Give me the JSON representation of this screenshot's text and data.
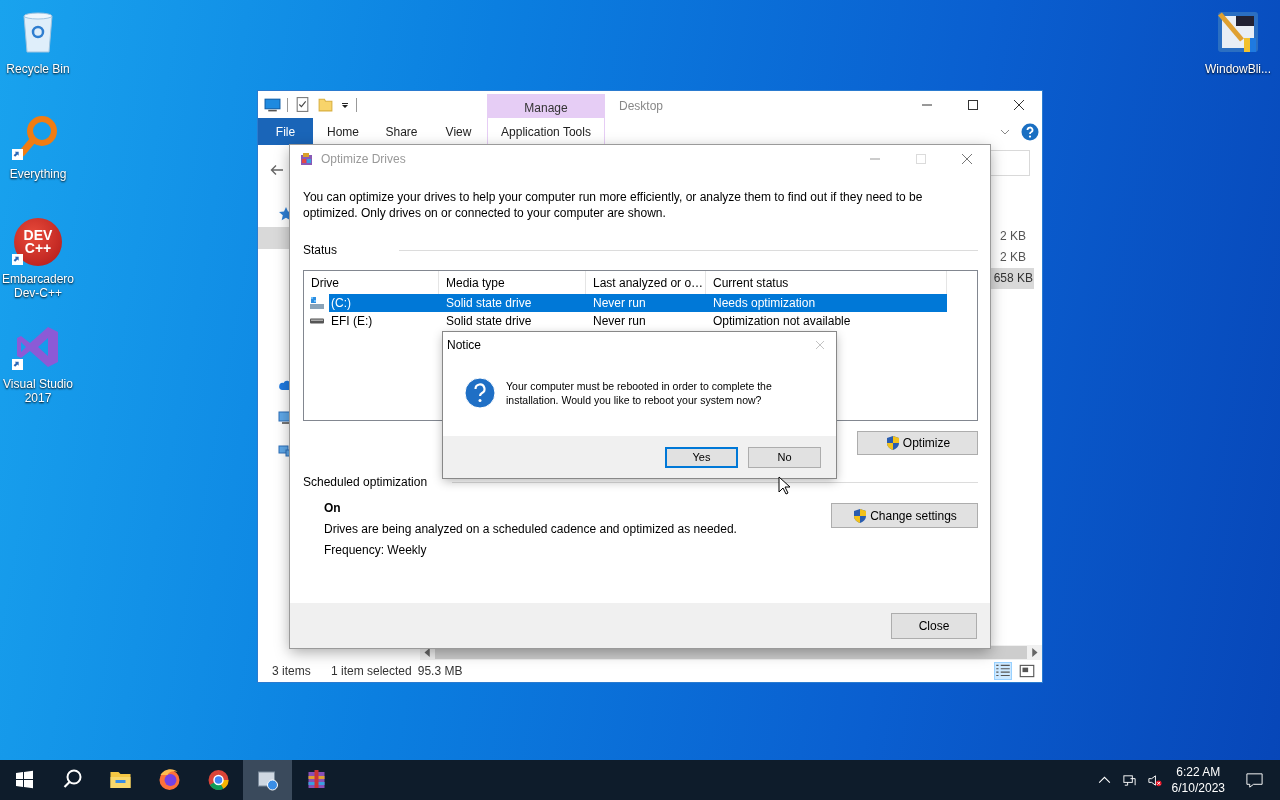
{
  "desktop_icons": [
    {
      "label": "Recycle Bin",
      "kind": "recycle",
      "shortcut": false
    },
    {
      "label": "Everything",
      "kind": "everything",
      "shortcut": true
    },
    {
      "label": "Embarcadero Dev-C++",
      "kind": "devcpp",
      "shortcut": true,
      "logo_text": [
        "DEV",
        "C++"
      ]
    },
    {
      "label": "Visual Studio 2017",
      "kind": "vs",
      "shortcut": true
    }
  ],
  "desktop_icons_right": [
    {
      "label": "WindowBli...",
      "kind": "windowblinds",
      "shortcut": false
    }
  ],
  "explorer": {
    "title": "Desktop",
    "context_header": "Manage",
    "tabs": [
      {
        "label": "File",
        "kind": "file",
        "selected": false
      },
      {
        "label": "Home",
        "kind": "plain",
        "selected": false
      },
      {
        "label": "Share",
        "kind": "plain",
        "selected": false
      },
      {
        "label": "View",
        "kind": "plain",
        "selected": false
      },
      {
        "label": "Application Tools",
        "kind": "context",
        "selected": false
      }
    ],
    "nav": [
      {
        "kind": "quick-access",
        "selected": false
      },
      {
        "kind": "folder",
        "selected": true
      },
      {
        "kind": "cloud",
        "selected": false
      },
      {
        "kind": "computer",
        "selected": false
      },
      {
        "kind": "network",
        "selected": false
      }
    ],
    "sizes": [
      {
        "text": "2 KB",
        "selected": false
      },
      {
        "text": "2 KB",
        "selected": false
      },
      {
        "text": "658 KB",
        "selected": true
      }
    ],
    "status_bar": {
      "item_count": "3 items",
      "selection": "1 item selected",
      "selection_size": "95.3 MB"
    }
  },
  "optimize": {
    "title": "Optimize Drives",
    "maximize_disabled": true,
    "intro": "You can optimize your drives to help your computer run more efficiently, or analyze them to find out if they need to be optimized. Only drives on or connected to your computer are shown.",
    "status_heading": "Status",
    "columns": [
      "Drive",
      "Media type",
      "Last analyzed or o…",
      "Current status"
    ],
    "drives": [
      {
        "name": "(C:)",
        "kind": "system",
        "media": "Solid state drive",
        "last": "Never run",
        "status": "Needs optimization",
        "selected": true
      },
      {
        "name": "EFI (E:)",
        "kind": "disk",
        "media": "Solid state drive",
        "last": "Never run",
        "status": "Optimization not available",
        "selected": false
      }
    ],
    "optimize_button": "Optimize",
    "scheduled_heading": "Scheduled optimization",
    "schedule_state": "On",
    "schedule_text": "Drives are being analyzed on a scheduled cadence and optimized as needed.",
    "frequency": "Frequency: Weekly",
    "change_button": "Change settings",
    "close_button": "Close"
  },
  "notice": {
    "title": "Notice",
    "close_disabled": true,
    "message": "Your computer must be rebooted in order to complete the installation. Would you like to reboot your system now?",
    "buttons": [
      {
        "label": "Yes",
        "focused": true
      },
      {
        "label": "No",
        "focused": false
      }
    ]
  },
  "taskbar": {
    "apps": [
      {
        "kind": "explorer",
        "selected": false
      },
      {
        "kind": "firefox",
        "selected": false
      },
      {
        "kind": "chrome",
        "selected": false
      },
      {
        "kind": "defrag",
        "selected": true
      },
      {
        "kind": "winrar",
        "selected": false
      }
    ],
    "clock": {
      "time": "6:22 AM",
      "date": "6/10/2023"
    }
  }
}
